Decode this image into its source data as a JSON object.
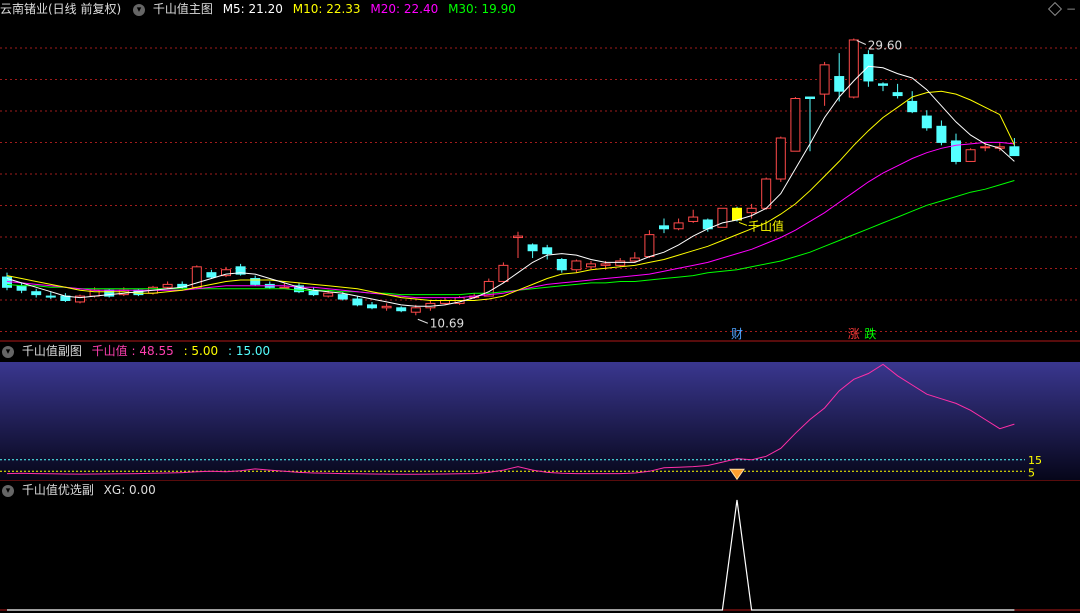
{
  "main_panel": {
    "stock_name": "云南锗业(日线 前复权)",
    "indicator": "千山值主图",
    "ma": [
      {
        "label": "M5: 21.20",
        "color": "#ffffff"
      },
      {
        "label": "M10: 22.33",
        "color": "#ffff00"
      },
      {
        "label": "M20: 22.40",
        "color": "#ff00ff"
      },
      {
        "label": "M30: 19.90",
        "color": "#00ff00"
      }
    ],
    "high_label": "29.60",
    "low_label": "10.69",
    "signal_label": "千山值",
    "event_markers": [
      {
        "text": "财",
        "color": "#4fa3ff"
      },
      {
        "text": "涨",
        "color": "#ff3a3a"
      },
      {
        "text": "跌",
        "color": "#00ff00"
      }
    ]
  },
  "sub_panel": {
    "title": "千山值副图",
    "name": "千山值",
    "value": ": 48.55",
    "l5": ": 5.00",
    "l15": ": 15.00",
    "level15": "15",
    "level5": "5"
  },
  "select_panel": {
    "title": "千山值优选副",
    "xg": "XG: 0.00"
  },
  "colors": {
    "up": "#ff4a4a",
    "down": "#54ffff",
    "grid": "#a01c1c",
    "ma5": "#ffffff",
    "ma10": "#ffff00",
    "ma20": "#ff00ff",
    "ma30": "#00ff00"
  },
  "chart_data": {
    "type": "candlestick",
    "y_range_main": [
      9.0,
      31.0
    ],
    "candles": [
      [
        13.3,
        12.6,
        13.6,
        12.4
      ],
      [
        12.7,
        12.4,
        12.9,
        12.2
      ],
      [
        12.3,
        12.1,
        12.5,
        11.9
      ],
      [
        12.0,
        11.95,
        12.3,
        11.8
      ],
      [
        12.0,
        11.7,
        12.2,
        11.6
      ],
      [
        11.6,
        12.0,
        12.1,
        11.5
      ],
      [
        12.0,
        12.4,
        12.6,
        11.9
      ],
      [
        12.4,
        12.0,
        12.5,
        11.9
      ],
      [
        12.1,
        12.4,
        12.6,
        12.0
      ],
      [
        12.4,
        12.1,
        12.5,
        12.0
      ],
      [
        12.2,
        12.6,
        12.7,
        12.1
      ],
      [
        12.6,
        12.8,
        13.0,
        12.5
      ],
      [
        12.8,
        12.6,
        13.0,
        12.5
      ],
      [
        12.6,
        14.0,
        14.1,
        12.5
      ],
      [
        13.6,
        13.3,
        13.8,
        13.2
      ],
      [
        13.4,
        13.8,
        14.0,
        13.3
      ],
      [
        14.0,
        13.5,
        14.2,
        13.4
      ],
      [
        13.2,
        12.8,
        13.4,
        12.7
      ],
      [
        12.8,
        12.6,
        13.0,
        12.5
      ],
      [
        12.6,
        12.6,
        12.9,
        12.5
      ],
      [
        12.7,
        12.3,
        12.9,
        12.2
      ],
      [
        12.4,
        12.1,
        12.6,
        12.0
      ],
      [
        12.0,
        12.2,
        12.4,
        11.9
      ],
      [
        12.1,
        11.8,
        12.3,
        11.7
      ],
      [
        11.8,
        11.4,
        12.0,
        11.3
      ],
      [
        11.4,
        11.2,
        11.6,
        11.1
      ],
      [
        11.2,
        11.3,
        11.5,
        11.0
      ],
      [
        11.2,
        11.0,
        11.3,
        10.9
      ],
      [
        10.9,
        11.2,
        11.4,
        10.69
      ],
      [
        11.2,
        11.5,
        11.7,
        11.0
      ],
      [
        11.5,
        11.7,
        11.9,
        11.4
      ],
      [
        11.5,
        11.9,
        12.0,
        11.4
      ],
      [
        11.9,
        12.0,
        12.2,
        11.8
      ],
      [
        12.0,
        13.0,
        13.2,
        12.0
      ],
      [
        13.0,
        14.1,
        14.3,
        12.9
      ],
      [
        16.0,
        16.1,
        16.4,
        14.6
      ],
      [
        15.5,
        15.1,
        15.6,
        14.6
      ],
      [
        15.3,
        14.9,
        15.5,
        14.5
      ],
      [
        14.5,
        13.8,
        14.6,
        13.6
      ],
      [
        13.8,
        14.4,
        14.5,
        13.6
      ],
      [
        14.0,
        14.2,
        14.4,
        13.9
      ],
      [
        14.1,
        14.2,
        14.4,
        13.8
      ],
      [
        14.1,
        14.4,
        14.6,
        14.0
      ],
      [
        14.4,
        14.6,
        15.0,
        14.3
      ],
      [
        14.7,
        16.2,
        16.5,
        14.6
      ],
      [
        16.8,
        16.6,
        17.3,
        16.3
      ],
      [
        16.6,
        17.0,
        17.3,
        16.5
      ],
      [
        17.1,
        17.4,
        17.9,
        17.0
      ],
      [
        17.2,
        16.6,
        17.3,
        16.4
      ],
      [
        16.7,
        18.0,
        18.0,
        16.7
      ],
      [
        18.0,
        17.2,
        18.1,
        17.1
      ],
      [
        17.7,
        18.0,
        18.3,
        17.3
      ],
      [
        18.0,
        20.0,
        20.1,
        17.9
      ],
      [
        20.0,
        22.8,
        22.9,
        19.8
      ],
      [
        21.9,
        25.5,
        25.6,
        21.9
      ],
      [
        25.6,
        25.5,
        25.6,
        21.9
      ],
      [
        25.8,
        27.8,
        28.0,
        25.0
      ],
      [
        27.0,
        26.0,
        28.6,
        25.3
      ],
      [
        25.6,
        29.5,
        29.6,
        25.5
      ],
      [
        28.5,
        26.7,
        28.8,
        26.3
      ],
      [
        26.5,
        26.4,
        26.6,
        26.0
      ],
      [
        25.9,
        25.7,
        26.5,
        25.5
      ],
      [
        25.3,
        24.6,
        26.0,
        24.5
      ],
      [
        24.3,
        23.5,
        24.7,
        23.3
      ],
      [
        23.6,
        22.5,
        24.0,
        22.3
      ],
      [
        22.6,
        21.2,
        23.1,
        21.0
      ],
      [
        21.2,
        22.0,
        22.1,
        21.2
      ],
      [
        22.2,
        22.2,
        22.5,
        21.9
      ],
      [
        22.1,
        22.2,
        22.5,
        21.9
      ],
      [
        22.2,
        21.6,
        22.8,
        21.6
      ]
    ],
    "ma5": [
      13.2,
      12.9,
      12.6,
      12.3,
      12.0,
      11.9,
      12.0,
      12.1,
      12.2,
      12.3,
      12.4,
      12.5,
      12.6,
      12.9,
      13.2,
      13.5,
      13.6,
      13.5,
      13.2,
      12.9,
      12.6,
      12.4,
      12.3,
      12.2,
      12.0,
      11.8,
      11.6,
      11.4,
      11.3,
      11.3,
      11.4,
      11.6,
      11.9,
      12.3,
      12.9,
      13.6,
      14.3,
      14.8,
      14.9,
      14.8,
      14.5,
      14.3,
      14.3,
      14.3,
      14.7,
      15.0,
      15.5,
      16.1,
      16.6,
      17.0,
      17.2,
      17.5,
      18.0,
      19.0,
      20.7,
      22.4,
      24.2,
      25.6,
      26.7,
      27.7,
      27.6,
      27.2,
      26.9,
      26.1,
      25.0,
      23.9,
      23.0,
      22.4,
      22.1,
      21.2
    ],
    "ma10": [
      13.4,
      13.2,
      13.0,
      12.8,
      12.6,
      12.4,
      12.3,
      12.3,
      12.3,
      12.2,
      12.2,
      12.3,
      12.4,
      12.6,
      12.8,
      13.0,
      13.1,
      13.1,
      13.1,
      13.0,
      12.9,
      12.8,
      12.7,
      12.6,
      12.5,
      12.3,
      12.1,
      11.9,
      11.8,
      11.7,
      11.7,
      11.7,
      11.7,
      11.8,
      12.0,
      12.4,
      12.8,
      13.2,
      13.5,
      13.6,
      13.8,
      13.9,
      14.0,
      14.1,
      14.3,
      14.5,
      14.8,
      15.1,
      15.4,
      15.8,
      16.2,
      16.6,
      17.0,
      17.6,
      18.3,
      19.2,
      20.2,
      21.2,
      22.3,
      23.3,
      24.2,
      24.9,
      25.6,
      25.9,
      26.0,
      25.8,
      25.4,
      24.9,
      24.4,
      22.33
    ],
    "ma20": [
      13.0,
      12.9,
      12.8,
      12.7,
      12.6,
      12.5,
      12.4,
      12.4,
      12.4,
      12.4,
      12.4,
      12.4,
      12.4,
      12.5,
      12.6,
      12.7,
      12.7,
      12.7,
      12.7,
      12.7,
      12.6,
      12.6,
      12.5,
      12.4,
      12.3,
      12.2,
      12.1,
      12.0,
      11.9,
      11.9,
      11.9,
      11.9,
      12.0,
      12.1,
      12.2,
      12.4,
      12.6,
      12.8,
      12.9,
      13.0,
      13.1,
      13.2,
      13.3,
      13.4,
      13.5,
      13.7,
      13.9,
      14.1,
      14.3,
      14.6,
      14.9,
      15.2,
      15.6,
      16.0,
      16.5,
      17.1,
      17.7,
      18.4,
      19.1,
      19.8,
      20.4,
      20.9,
      21.4,
      21.8,
      22.1,
      22.3,
      22.4,
      22.5,
      22.5,
      22.4
    ],
    "ma30": [
      12.8,
      12.7,
      12.7,
      12.6,
      12.6,
      12.5,
      12.5,
      12.5,
      12.5,
      12.5,
      12.5,
      12.5,
      12.5,
      12.5,
      12.5,
      12.5,
      12.5,
      12.5,
      12.5,
      12.5,
      12.4,
      12.4,
      12.4,
      12.3,
      12.3,
      12.2,
      12.2,
      12.1,
      12.1,
      12.1,
      12.1,
      12.1,
      12.2,
      12.2,
      12.3,
      12.4,
      12.5,
      12.6,
      12.7,
      12.8,
      12.9,
      12.9,
      13.0,
      13.0,
      13.1,
      13.2,
      13.3,
      13.4,
      13.6,
      13.7,
      13.8,
      14.0,
      14.2,
      14.4,
      14.7,
      15.0,
      15.4,
      15.8,
      16.2,
      16.6,
      17.0,
      17.4,
      17.8,
      18.2,
      18.5,
      18.8,
      19.1,
      19.3,
      19.6,
      19.9
    ],
    "qsz": [
      3.0,
      3.2,
      3.0,
      2.8,
      2.6,
      2.5,
      2.6,
      2.7,
      2.8,
      3.0,
      3.2,
      3.5,
      3.8,
      4.5,
      5.0,
      4.5,
      5.5,
      7.0,
      6.0,
      5.0,
      4.0,
      3.5,
      3.2,
      3.0,
      2.8,
      2.6,
      2.5,
      2.4,
      2.4,
      2.5,
      2.6,
      2.8,
      3.0,
      4.0,
      6.0,
      9.0,
      6.0,
      4.0,
      3.2,
      3.0,
      3.0,
      3.0,
      3.0,
      3.5,
      5.0,
      8.0,
      8.5,
      9.0,
      10.0,
      13.0,
      16.0,
      15.0,
      18.0,
      25.0,
      38.0,
      50.0,
      60.0,
      75.0,
      85.0,
      90.0,
      98.0,
      88.0,
      80.0,
      72.0,
      68.0,
      64.0,
      58.0,
      50.0,
      42.0,
      46.0,
      48.0,
      48.55
    ],
    "xg": [
      0,
      0,
      0,
      0,
      0,
      0,
      0,
      0,
      0,
      0,
      0,
      0,
      0,
      0,
      0,
      0,
      0,
      0,
      0,
      0,
      0,
      0,
      0,
      0,
      0,
      0,
      0,
      0,
      0,
      0,
      0,
      0,
      0,
      0,
      0,
      0,
      0,
      0,
      0,
      0,
      0,
      0,
      0,
      0,
      0,
      0,
      0,
      0,
      0,
      0,
      1,
      0,
      0,
      0,
      0,
      0,
      0,
      0,
      0,
      0,
      0,
      0,
      0,
      0,
      0,
      0,
      0,
      0,
      0,
      0
    ]
  }
}
